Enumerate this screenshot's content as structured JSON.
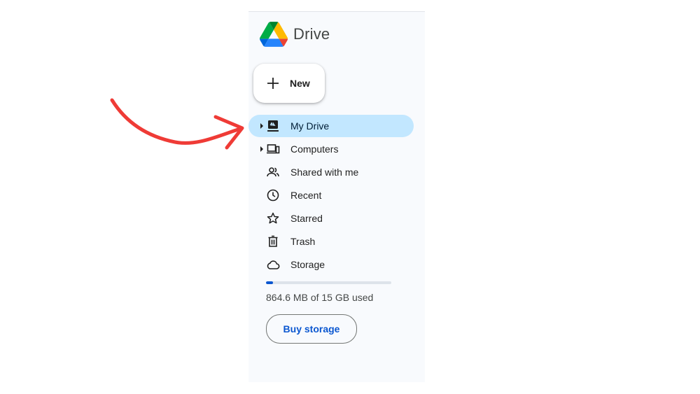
{
  "app": {
    "name": "Drive"
  },
  "new_button": {
    "label": "New",
    "icon": "plus-icon"
  },
  "nav": {
    "items": [
      {
        "label": "My Drive",
        "icon": "my-drive-icon",
        "active": true,
        "expandable": true
      },
      {
        "label": "Computers",
        "icon": "computers-icon",
        "active": false,
        "expandable": true
      },
      {
        "label": "Shared with me",
        "icon": "shared-icon",
        "active": false,
        "expandable": false
      },
      {
        "label": "Recent",
        "icon": "clock-icon",
        "active": false,
        "expandable": false
      },
      {
        "label": "Starred",
        "icon": "star-icon",
        "active": false,
        "expandable": false
      },
      {
        "label": "Trash",
        "icon": "trash-icon",
        "active": false,
        "expandable": false
      },
      {
        "label": "Storage",
        "icon": "cloud-icon",
        "active": false,
        "expandable": false
      }
    ]
  },
  "storage": {
    "used_text": "864.6 MB of 15 GB used",
    "used_fraction": 0.056,
    "buy_label": "Buy storage"
  },
  "colors": {
    "panel_bg": "#f8fafd",
    "active_bg": "#c2e7ff",
    "accent": "#0b57d0",
    "annotation_arrow": "#ef3b36"
  }
}
